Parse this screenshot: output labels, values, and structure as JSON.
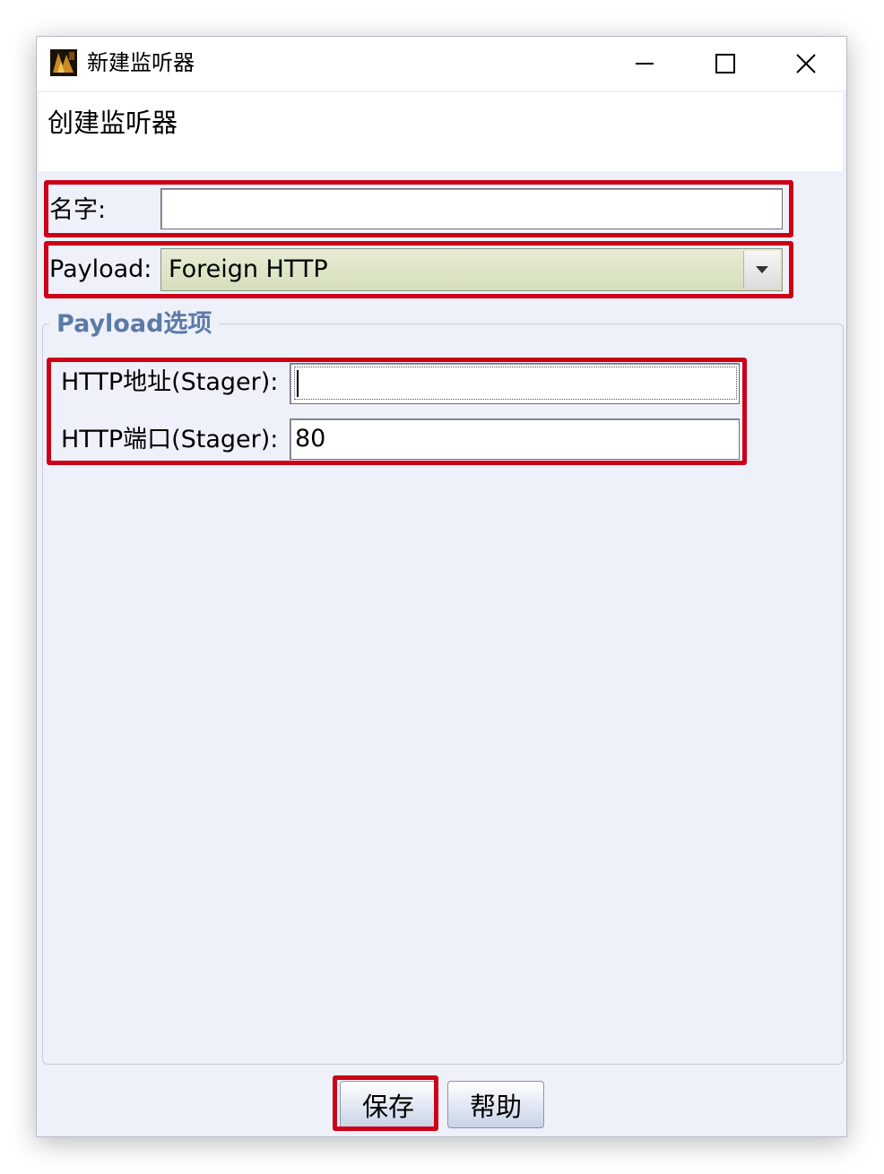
{
  "window": {
    "title": "新建监听器",
    "header_title": "创建监听器"
  },
  "form": {
    "name_label": "名字:",
    "name_value": "",
    "payload_label": "Payload:",
    "payload_value": "Foreign HTTP"
  },
  "payload_options": {
    "group_title": "Payload选项",
    "host_label": "HTTP地址(Stager):",
    "host_value": "",
    "port_label": "HTTP端口(Stager):",
    "port_value": "80"
  },
  "buttons": {
    "save": "保存",
    "help": "帮助"
  },
  "colors": {
    "highlight": "#cc0016",
    "group_title": "#5b7ba6",
    "window_bg": "#eef1fa"
  },
  "icons": [
    "app-icon",
    "minimize-icon",
    "maximize-icon",
    "close-icon",
    "dropdown-arrow-icon"
  ]
}
